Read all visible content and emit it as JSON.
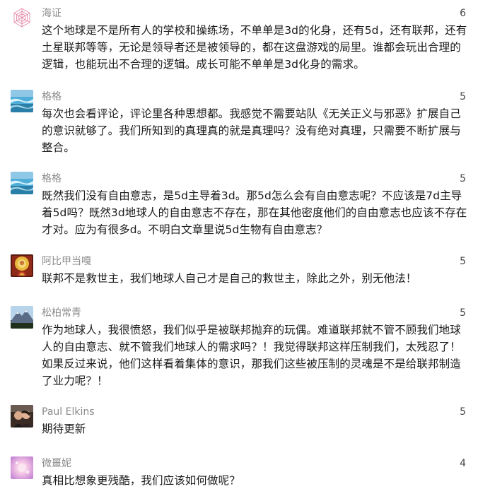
{
  "comments": [
    {
      "name": "海证",
      "count": "6",
      "avatar": "geometric-flower-icon",
      "text": "这个地球是不是所有人的学校和操练场，不单单是3d的化身，还有5d，还有联邦，还有土星联邦等等，无论是领导者还是被领导的，都在这盘游戏的局里。谁都会玩出合理的逻辑，也能玩出不合理的逻辑。成长可能不单单是3d化身的需求。"
    },
    {
      "name": "格格",
      "count": "5",
      "avatar": "ocean-avatar",
      "text": "每次也会看评论，评论里各种思想都。我感觉不需要站队《无关正义与邪恶》扩展自己的意识就够了。我们所知到的真理真的就是真理吗？没有绝对真理，只需要不断扩展与整合。"
    },
    {
      "name": "格格",
      "count": "5",
      "avatar": "ocean-avatar",
      "text": "既然我们没有自由意志，是5d主导着3d。那5d怎么会有自由意志呢？不应该是7d主导着5d吗？既然3d地球人的自由意志不存在，那在其他密度他们的自由意志也应该不存在才对。应为有很多d。不明白文章里说5d生物有自由意志？"
    },
    {
      "name": "阿比甲当嘎",
      "count": "5",
      "avatar": "deity-avatar",
      "text": "联邦不是救世主，我们地球人自己才是自己的救世主，除此之外，别无他法！"
    },
    {
      "name": "松柏常青",
      "count": "5",
      "avatar": "mountain-avatar",
      "text": "作为地球人，我很愤怒，我们似乎是被联邦抛弃的玩偶。难道联邦就不管不顾我们地球人的自由意志、就不管我们地球人的需求吗？！我觉得联邦这样压制我们，太残忍了！如果反过来说，他们这样看着集体的意识，那我们这些被压制的灵魂是不是给联邦制造了业力呢？！"
    },
    {
      "name": "Paul Elkins",
      "count": "5",
      "avatar": "person-avatar",
      "text": "期待更新"
    },
    {
      "name": "微噩妮",
      "count": "4",
      "avatar": "pink-glow-avatar",
      "text": "真相比想象更残酷，我们应该如何做呢？"
    }
  ]
}
